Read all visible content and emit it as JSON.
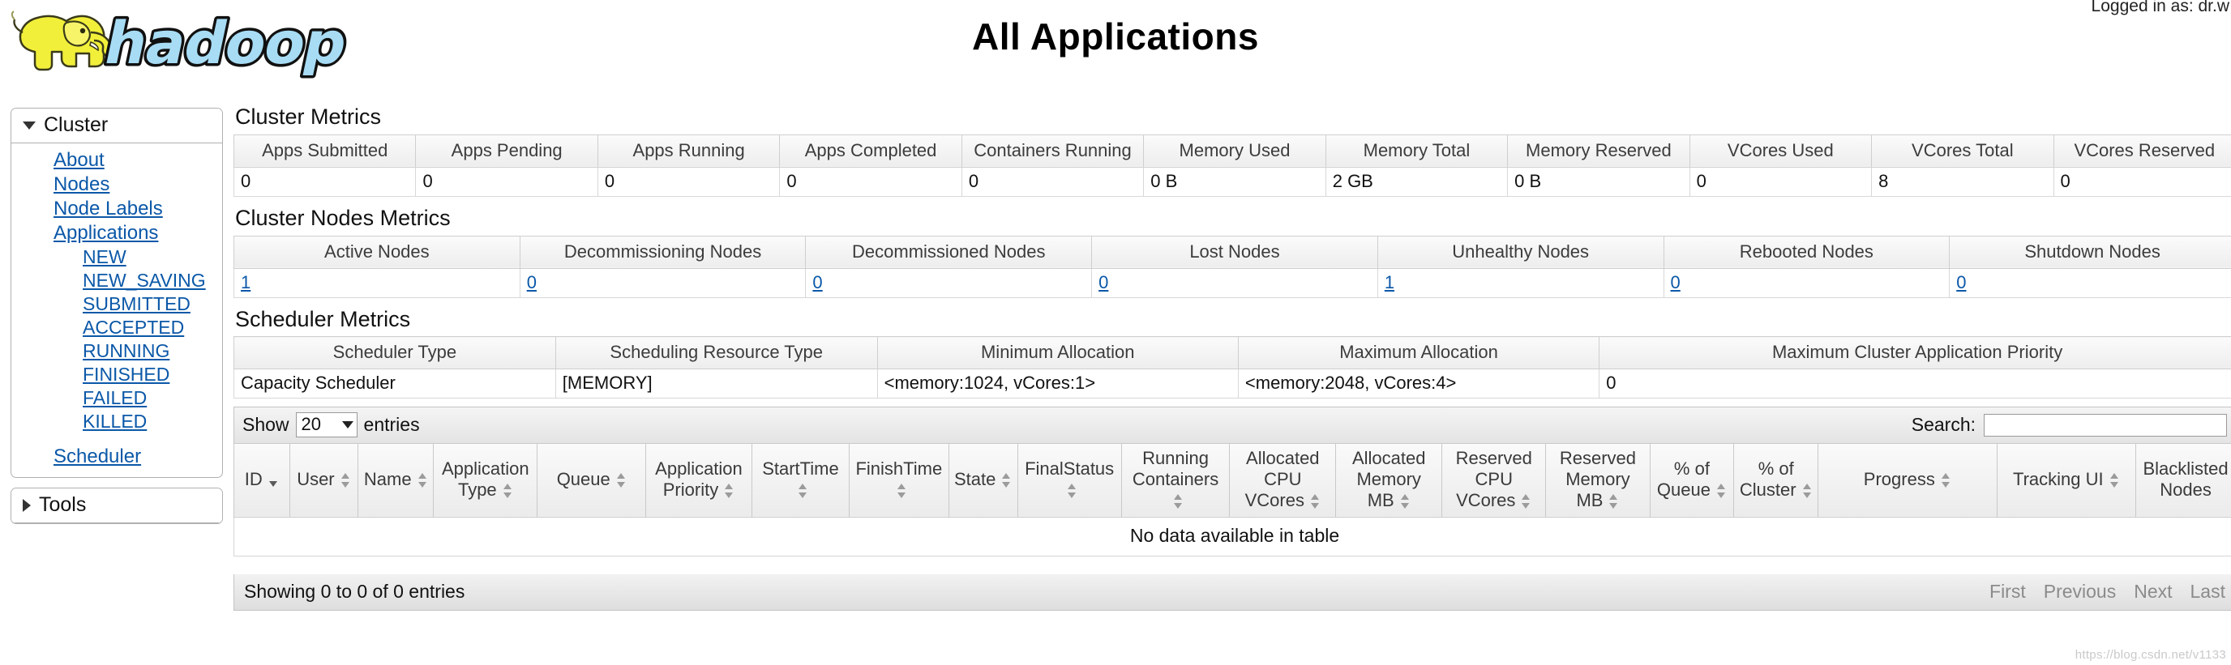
{
  "header": {
    "logged_in": "Logged in as: dr.w",
    "title": "All Applications",
    "logo_alt": "hadoop-logo"
  },
  "sidebar": {
    "cluster": {
      "label": "Cluster",
      "links": [
        {
          "label": "About"
        },
        {
          "label": "Nodes"
        },
        {
          "label": "Node Labels"
        },
        {
          "label": "Applications"
        }
      ],
      "app_states": [
        {
          "label": "NEW"
        },
        {
          "label": "NEW_SAVING"
        },
        {
          "label": "SUBMITTED"
        },
        {
          "label": "ACCEPTED"
        },
        {
          "label": "RUNNING"
        },
        {
          "label": "FINISHED"
        },
        {
          "label": "FAILED"
        },
        {
          "label": "KILLED"
        }
      ],
      "scheduler": {
        "label": "Scheduler"
      }
    },
    "tools": {
      "label": "Tools"
    }
  },
  "cluster_metrics": {
    "title": "Cluster Metrics",
    "headers": [
      "Apps Submitted",
      "Apps Pending",
      "Apps Running",
      "Apps Completed",
      "Containers Running",
      "Memory Used",
      "Memory Total",
      "Memory Reserved",
      "VCores Used",
      "VCores Total",
      "VCores Reserved"
    ],
    "values": [
      "0",
      "0",
      "0",
      "0",
      "0",
      "0 B",
      "2 GB",
      "0 B",
      "0",
      "8",
      "0"
    ]
  },
  "cluster_nodes_metrics": {
    "title": "Cluster Nodes Metrics",
    "headers": [
      "Active Nodes",
      "Decommissioning Nodes",
      "Decommissioned Nodes",
      "Lost Nodes",
      "Unhealthy Nodes",
      "Rebooted Nodes",
      "Shutdown Nodes"
    ],
    "values": [
      "1",
      "0",
      "0",
      "0",
      "1",
      "0",
      "0"
    ]
  },
  "scheduler_metrics": {
    "title": "Scheduler Metrics",
    "headers": [
      "Scheduler Type",
      "Scheduling Resource Type",
      "Minimum Allocation",
      "Maximum Allocation",
      "Maximum Cluster Application Priority"
    ],
    "values": [
      "Capacity Scheduler",
      "[MEMORY]",
      "<memory:1024, vCores:1>",
      "<memory:2048, vCores:4>",
      "0"
    ]
  },
  "datatable": {
    "show_label": "Show",
    "page_length": "20",
    "entries_label": "entries",
    "search_label": "Search:",
    "search_value": "",
    "columns": [
      {
        "label": "ID",
        "sort": "desc"
      },
      {
        "label": "User",
        "sort": "both"
      },
      {
        "label": "Name",
        "sort": "both"
      },
      {
        "label": "Application Type",
        "sort": "both"
      },
      {
        "label": "Queue",
        "sort": "both"
      },
      {
        "label": "Application Priority",
        "sort": "both"
      },
      {
        "label": "StartTime",
        "sort": "both"
      },
      {
        "label": "FinishTime",
        "sort": "both"
      },
      {
        "label": "State",
        "sort": "both"
      },
      {
        "label": "FinalStatus",
        "sort": "both"
      },
      {
        "label": "Running Containers",
        "sort": "both"
      },
      {
        "label": "Allocated CPU VCores",
        "sort": "both"
      },
      {
        "label": "Allocated Memory MB",
        "sort": "both"
      },
      {
        "label": "Reserved CPU VCores",
        "sort": "both"
      },
      {
        "label": "Reserved Memory MB",
        "sort": "both"
      },
      {
        "label": "% of Queue",
        "sort": "both"
      },
      {
        "label": "% of Cluster",
        "sort": "both"
      },
      {
        "label": "Progress",
        "sort": "both"
      },
      {
        "label": "Tracking UI",
        "sort": "both"
      },
      {
        "label": "Blacklisted Nodes",
        "sort": "none"
      }
    ],
    "empty_message": "No data available in table",
    "info": "Showing 0 to 0 of 0 entries",
    "pager": [
      "First",
      "Previous",
      "Next",
      "Last"
    ]
  },
  "watermark": "https://blog.csdn.net/v1133"
}
